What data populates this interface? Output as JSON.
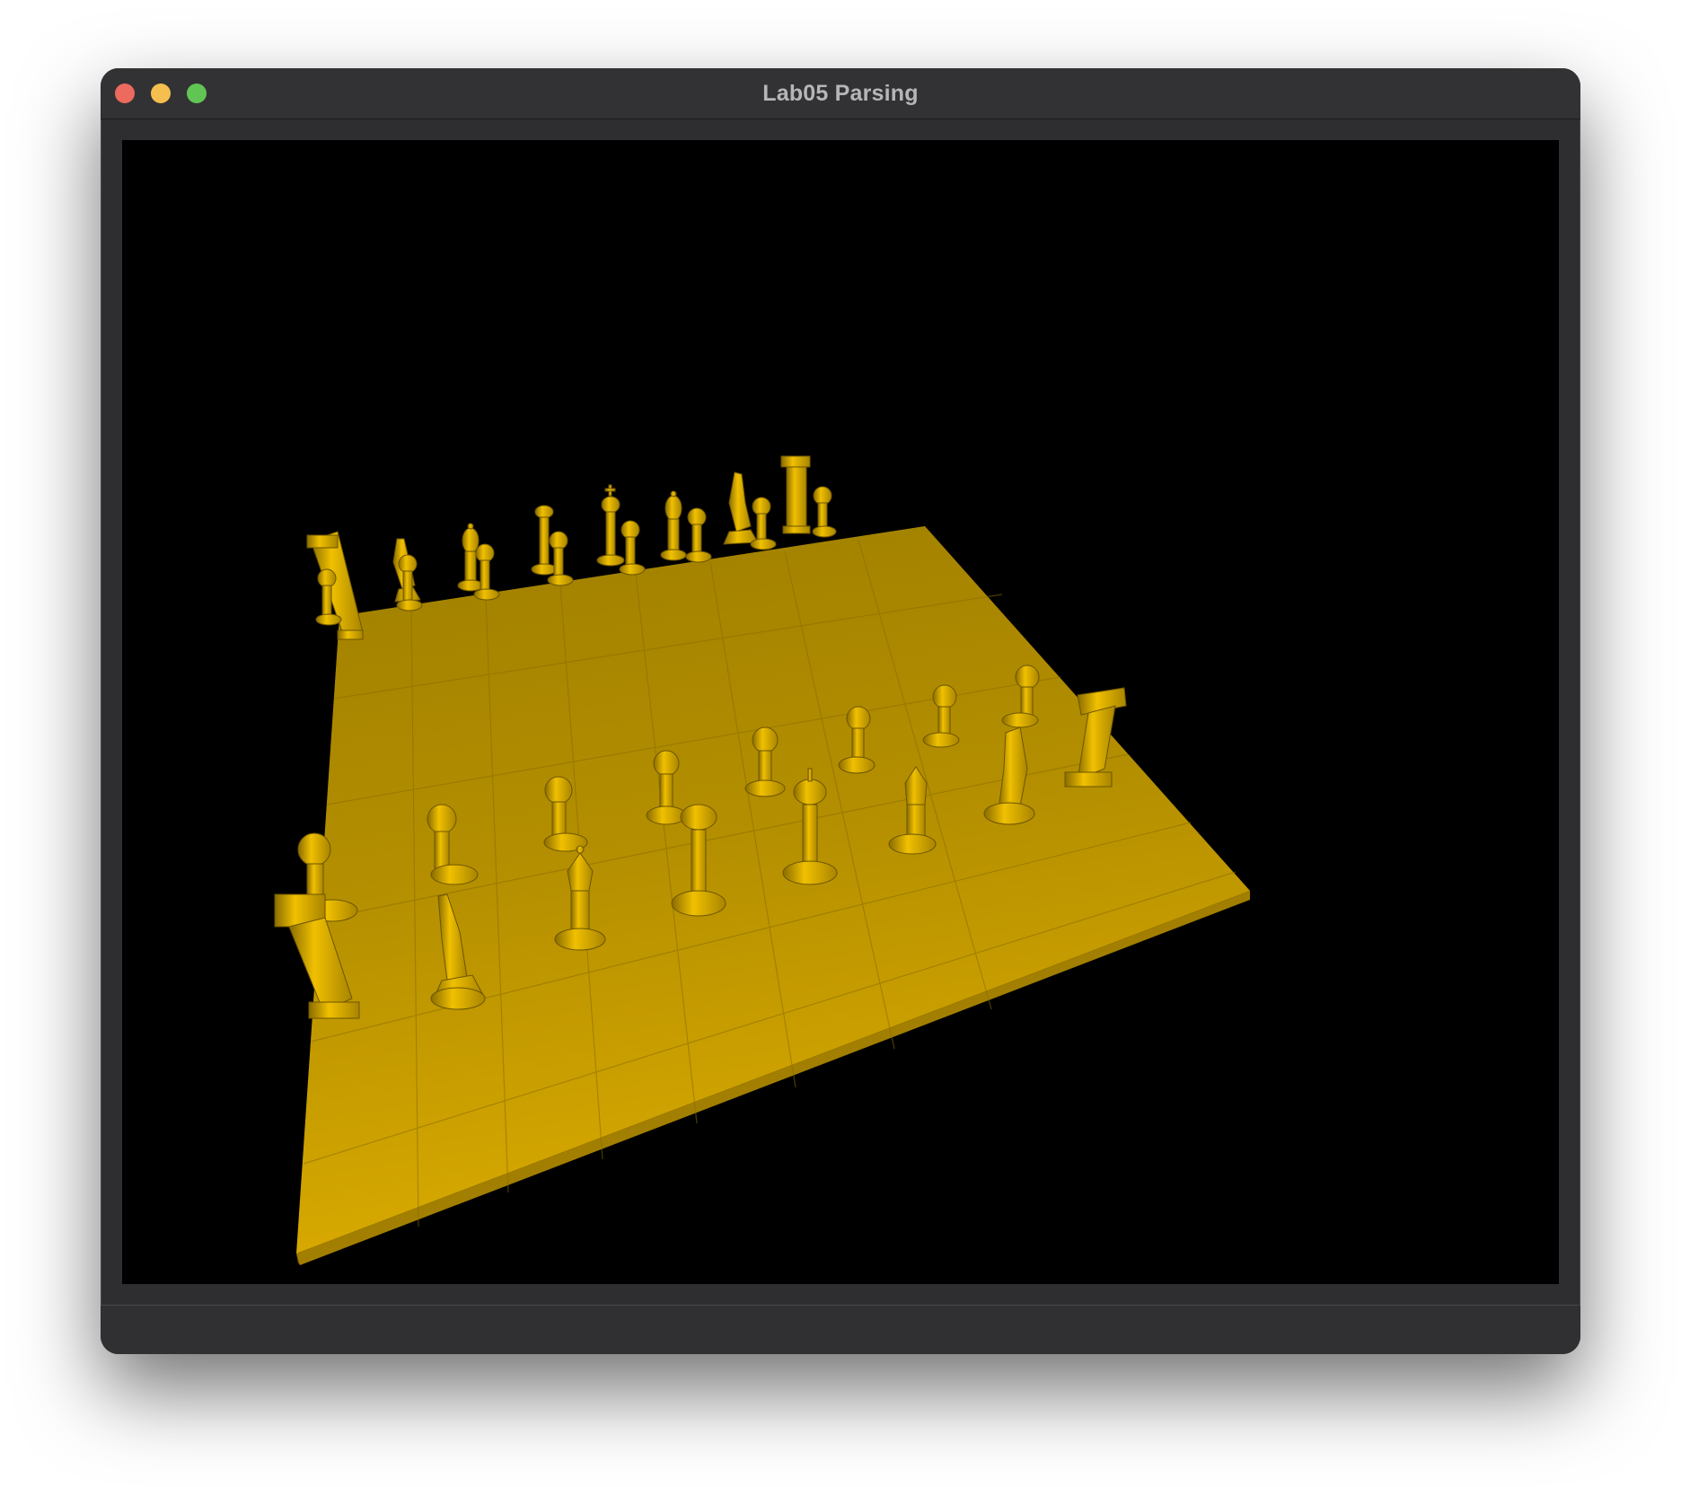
{
  "window": {
    "title": "Lab05 Parsing"
  },
  "scene": {
    "description_color": "#d4a800",
    "background_color": "#000000",
    "board_color": "#c99f00",
    "piece_color": "#e0b000",
    "pieces": [
      {
        "name": "rook",
        "row": "back-far"
      },
      {
        "name": "knight",
        "row": "back-far"
      },
      {
        "name": "bishop",
        "row": "back-far"
      },
      {
        "name": "queen",
        "row": "back-far"
      },
      {
        "name": "king",
        "row": "back-far"
      },
      {
        "name": "bishop",
        "row": "back-far"
      },
      {
        "name": "knight",
        "row": "back-far"
      },
      {
        "name": "rook",
        "row": "back-far"
      },
      {
        "name": "rook",
        "row": "back-near"
      },
      {
        "name": "knight",
        "row": "back-near"
      },
      {
        "name": "bishop",
        "row": "back-near"
      },
      {
        "name": "queen",
        "row": "back-near"
      },
      {
        "name": "king",
        "row": "back-near"
      },
      {
        "name": "bishop",
        "row": "back-near"
      },
      {
        "name": "knight",
        "row": "back-near"
      },
      {
        "name": "rook",
        "row": "back-near"
      }
    ]
  }
}
